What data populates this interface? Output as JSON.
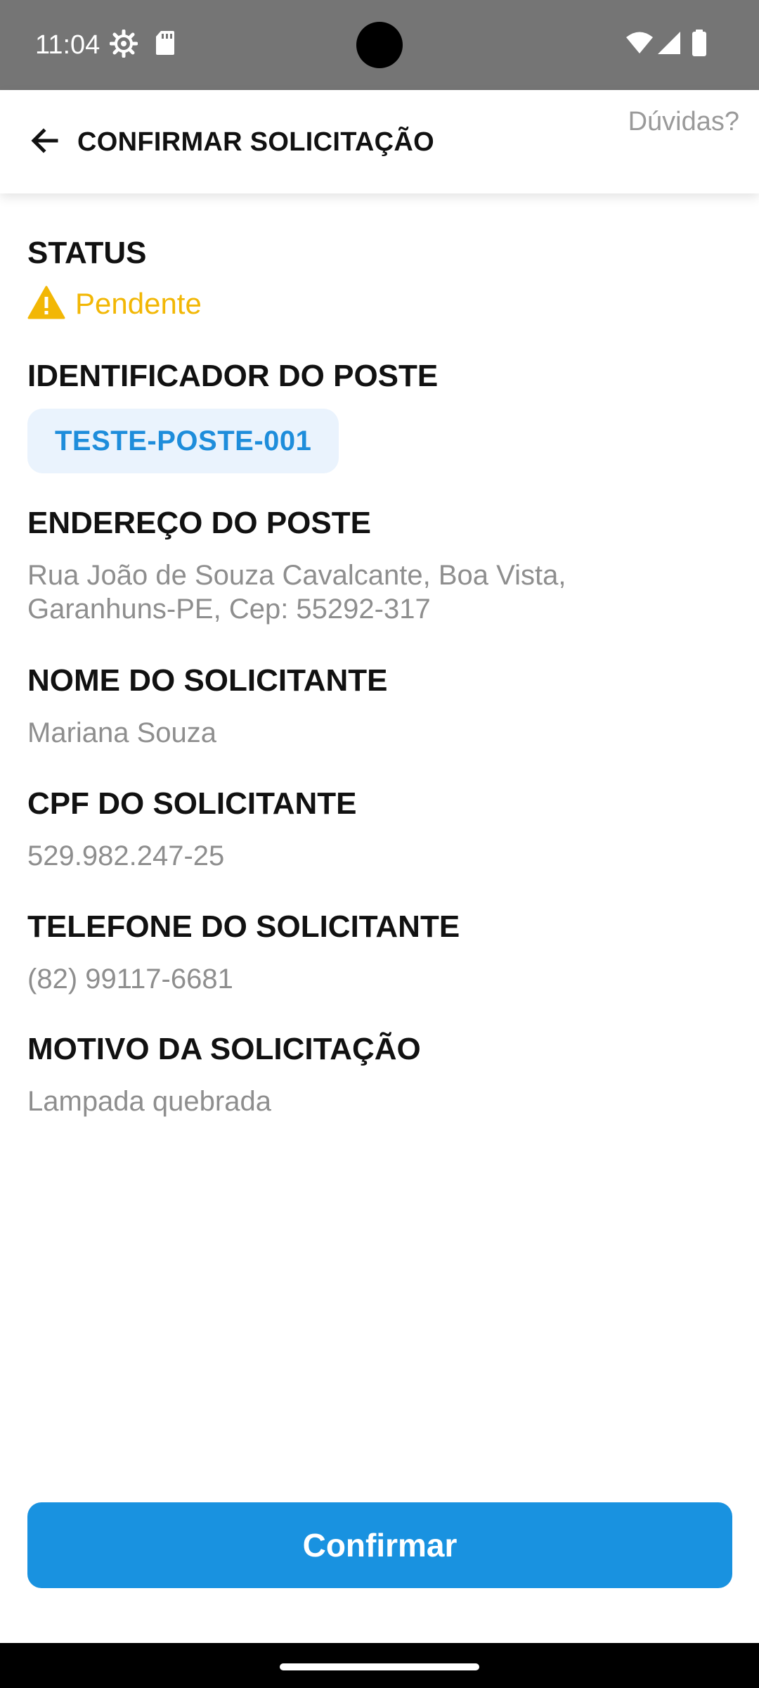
{
  "status_bar": {
    "time": "11:04",
    "icons": [
      "settings-gear-icon",
      "sd-card-icon",
      "wifi-icon",
      "cellular-signal-icon",
      "battery-icon"
    ]
  },
  "app_bar": {
    "title": "CONFIRMAR SOLICITAÇÃO",
    "help_label": "Dúvidas?"
  },
  "details": {
    "status_label": "STATUS",
    "status_value": "Pendente",
    "status_color": "#f2b705",
    "pole_id_label": "IDENTIFICADOR DO POSTE",
    "pole_id_value": "TESTE-POSTE-001",
    "address_label": "ENDEREÇO DO POSTE",
    "address_line1": "Rua João de Souza Cavalcante, Boa Vista,",
    "address_line2": "Garanhuns-PE, Cep: 55292-317",
    "name_label": "NOME DO SOLICITANTE",
    "name_value": "Mariana Souza",
    "cpf_label": "CPF DO SOLICITANTE",
    "cpf_value": "529.982.247-25",
    "phone_label": "TELEFONE DO SOLICITANTE",
    "phone_value": "(82) 99117-6681",
    "reason_label": "MOTIVO DA SOLICITAÇÃO",
    "reason_value": "Lampada quebrada"
  },
  "actions": {
    "confirm_label": "Confirmar",
    "primary_color": "#1992e0"
  }
}
